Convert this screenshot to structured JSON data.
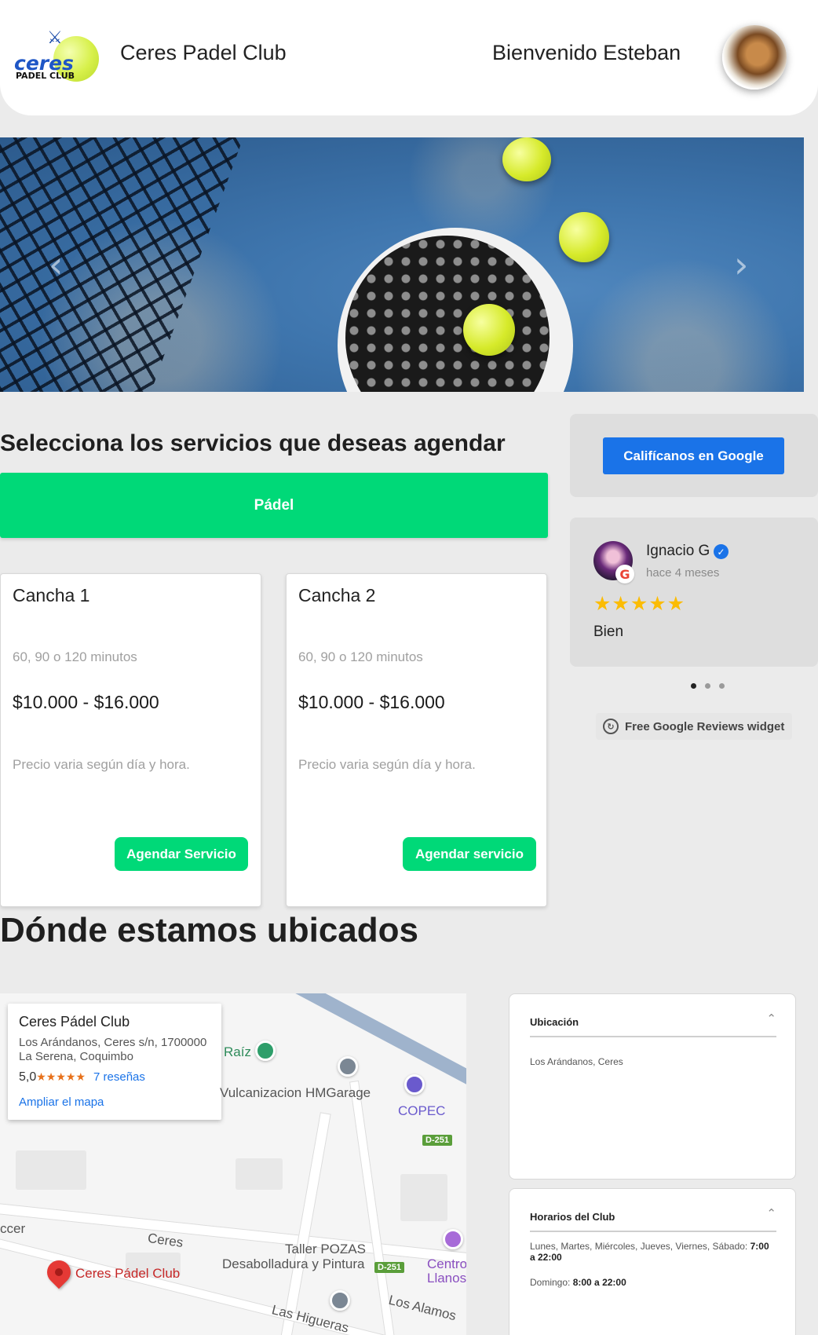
{
  "header": {
    "logo_text_top": "ceres",
    "logo_text_bottom": "PADEL CLUB",
    "club_name": "Ceres Padel Club",
    "welcome": "Bienvenido Esteban"
  },
  "carousel": {
    "prev_icon": "chevron-left-icon",
    "next_icon": "chevron-right-icon",
    "prev_glyph": "‹",
    "next_glyph": "›"
  },
  "services": {
    "title": "Selecciona los servicios que deseas agendar",
    "category": "Pádel",
    "cards": [
      {
        "title": "Cancha 1",
        "duration": "60, 90 o 120 minutos",
        "price": "$10.000 - $16.000",
        "note": "Precio varia según día y hora.",
        "button": "Agendar Servicio"
      },
      {
        "title": "Cancha 2",
        "duration": "60, 90 o 120 minutos",
        "price": "$10.000 - $16.000",
        "note": "Precio varia según día y hora.",
        "button": "Agendar servicio"
      }
    ]
  },
  "reviews": {
    "rate_button": "Califícanos en Google",
    "review": {
      "name": "Ignacio G",
      "time": "hace 4 meses",
      "stars": "★★★★★",
      "rating": 5,
      "text": "Bien"
    },
    "dots": 3,
    "active_dot": 0,
    "widget_label": "Free Google Reviews widget"
  },
  "location": {
    "title": "Dónde estamos ubicados",
    "map": {
      "place_name": "Ceres Pádel Club",
      "address_line1": "Los Arándanos, Ceres s/n, 1700000",
      "address_line2": "La Serena, Coquimbo",
      "rating": "5,0",
      "stars": "★★★★★",
      "reviews_link": "7 reseñas",
      "expand_link": "Ampliar el mapa",
      "labels": {
        "raiz": "Raíz",
        "vulcanizacion": "Vulcanizacion HMGarage",
        "copec": "COPEC",
        "road1": "D-251",
        "road2": "D-251",
        "ceres": "Ceres",
        "taller1": "Taller POZAS",
        "taller2": "Desabolladura y Pintura",
        "centro1": "Centro",
        "centro2": "Llanos",
        "pin_label": "Ceres Pádel Club",
        "los_alamos": "Los Alamos",
        "las_higueras": "Las Higueras",
        "ccer": "ccer"
      }
    },
    "ubicacion": {
      "title": "Ubicación",
      "text": "Los Arándanos, Ceres"
    },
    "horarios": {
      "title": "Horarios del Club",
      "weekdays_label": "Lunes, Martes, Miércoles, Jueves, Viernes, Sábado:",
      "weekdays_hours": "7:00 a 22:00",
      "sunday_label": "Domingo:",
      "sunday_hours": "8:00 a 22:00"
    }
  },
  "colors": {
    "accent_green": "#00d978",
    "google_blue": "#1a73e8",
    "star_yellow": "#fbbc04",
    "page_bg": "#ebebeb"
  }
}
